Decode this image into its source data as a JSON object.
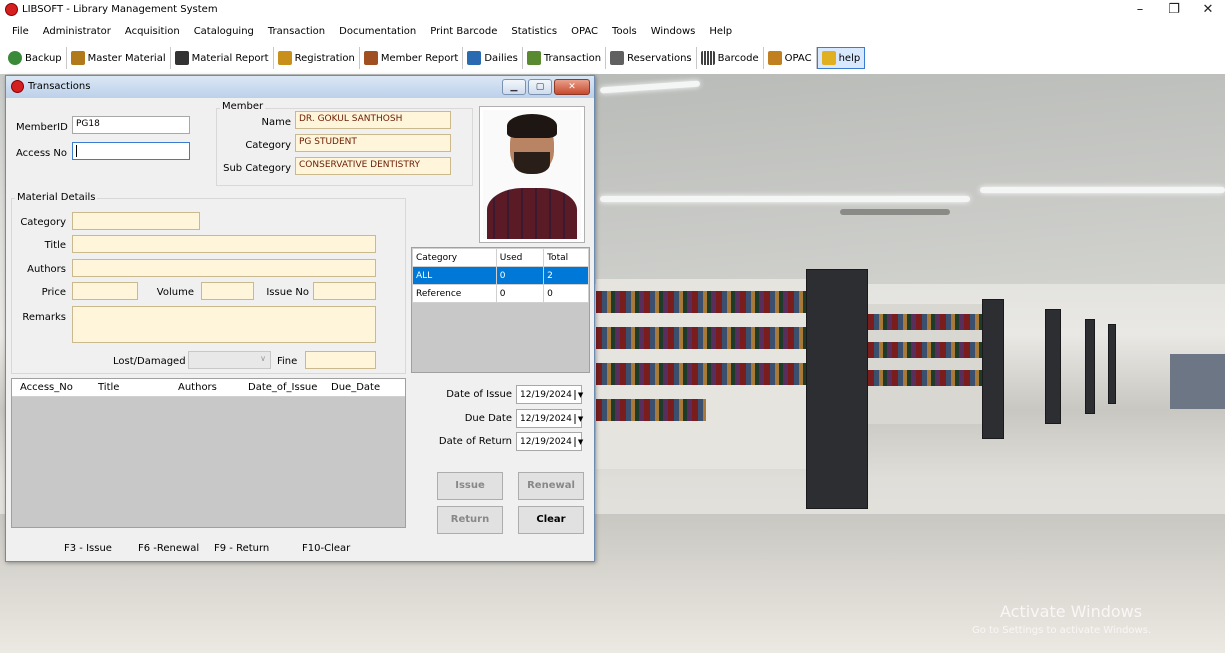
{
  "app": {
    "title": "LIBSOFT - Library Management System",
    "window_controls": [
      "–",
      "❐",
      "✕"
    ]
  },
  "menu": [
    "File",
    "Administrator",
    "Acquisition",
    "Cataloguing",
    "Transaction",
    "Documentation",
    "Print Barcode",
    "Statistics",
    "OPAC",
    "Tools",
    "Windows",
    "Help"
  ],
  "toolbar": [
    {
      "label": "Backup",
      "icon": "backup-icon",
      "color": "#3a8a3a"
    },
    {
      "label": "Master Material",
      "icon": "books-icon",
      "color": "#b07a1a"
    },
    {
      "label": "Material Report",
      "icon": "binoculars-icon",
      "color": "#333333"
    },
    {
      "label": "Registration",
      "icon": "registration-icon",
      "color": "#c8901a"
    },
    {
      "label": "Member Report",
      "icon": "members-icon",
      "color": "#a05020"
    },
    {
      "label": "Dailies",
      "icon": "dailies-icon",
      "color": "#2a6ab0"
    },
    {
      "label": "Transaction",
      "icon": "transaction-icon",
      "color": "#5a8a30"
    },
    {
      "label": "Reservations",
      "icon": "calendar-icon",
      "color": "#606060"
    },
    {
      "label": "Barcode",
      "icon": "barcode-icon",
      "color": "#404040"
    },
    {
      "label": "OPAC",
      "icon": "opac-icon",
      "color": "#c08020"
    },
    {
      "label": "help",
      "icon": "help-icon",
      "color": "#e0b020"
    }
  ],
  "tx": {
    "title": "Transactions",
    "member_group": "Member",
    "member_id_label": "MemberID",
    "member_id": "PG18",
    "access_no_label": "Access No",
    "access_no": "",
    "name_label": "Name",
    "name": "DR. GOKUL SANTHOSH",
    "category_label": "Category",
    "category": "PG STUDENT",
    "subcategory_label": "Sub Category",
    "subcategory": "CONSERVATIVE DENTISTRY",
    "material_group": "Material Details",
    "m_category_label": "Category",
    "m_title_label": "Title",
    "m_authors_label": "Authors",
    "m_price_label": "Price",
    "m_volume_label": "Volume",
    "m_issue_label": "Issue No",
    "m_remarks_label": "Remarks",
    "lost_label": "Lost/Damaged",
    "fine_label": "Fine",
    "cat_headers": [
      "Category",
      "Used",
      "Total"
    ],
    "cat_rows": [
      [
        "ALL",
        "0",
        "2"
      ],
      [
        "Reference",
        "0",
        "0"
      ]
    ],
    "grid_headers": [
      "Access_No",
      "Title",
      "Authors",
      "Date_of_Issue",
      "Due_Date"
    ],
    "date_issue_label": "Date of Issue",
    "date_issue": "12/19/2024",
    "due_date_label": "Due Date",
    "due_date": "12/19/2024",
    "date_return_label": "Date of Return",
    "date_return": "12/19/2024",
    "buttons": {
      "issue": "Issue",
      "renewal": "Renewal",
      "return": "Return",
      "clear": "Clear"
    },
    "shortcuts": [
      "F3 - Issue",
      "F6 -Renewal",
      "F9 - Return",
      "F10-Clear"
    ]
  },
  "watermark": {
    "line1": "Activate Windows",
    "line2": "Go to Settings to activate Windows."
  }
}
